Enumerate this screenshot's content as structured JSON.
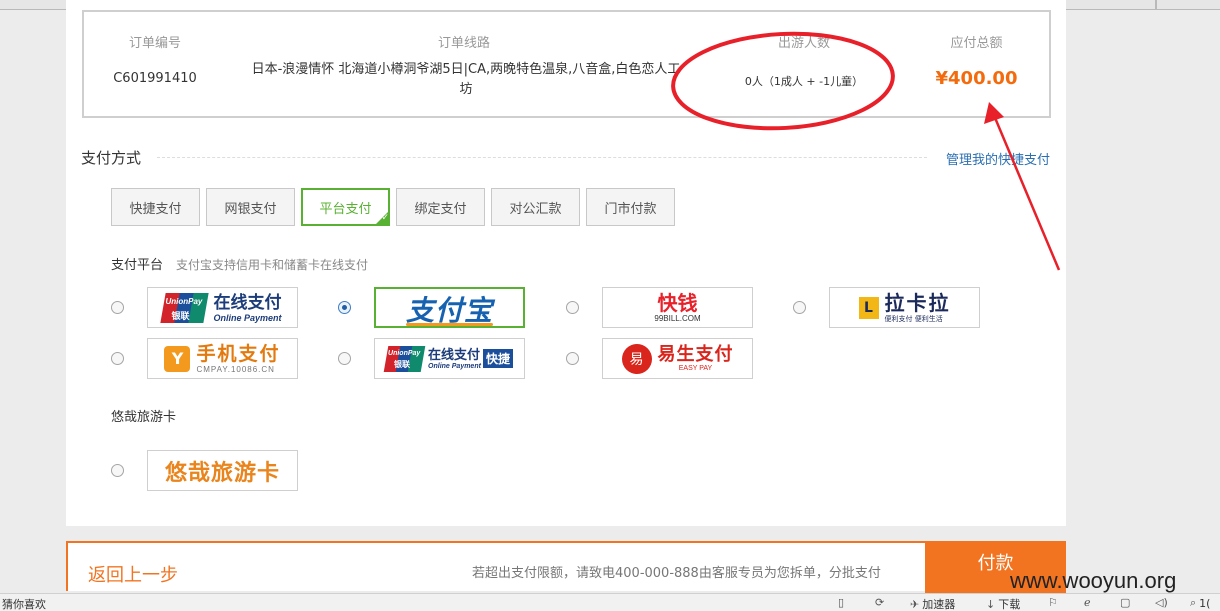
{
  "order": {
    "headers": {
      "order_no": "订单编号",
      "route": "订单线路",
      "travelers": "出游人数",
      "total": "应付总额"
    },
    "order_no": "C601991410",
    "route_line1": "日本-浪漫情怀 北海道小樽洞爷湖5日|CA,两晚特色温泉,八音盒,白色恋人工",
    "route_line2": "坊",
    "travelers": "0人（1成人 + -1儿童）",
    "total": "¥400.00"
  },
  "payment": {
    "title": "支付方式",
    "manage_link": "管理我的快捷支付",
    "methods": [
      "快捷支付",
      "网银支付",
      "平台支付",
      "绑定支付",
      "对公汇款",
      "门市付款"
    ],
    "selected_method": "平台支付",
    "platform_label": "支付平台",
    "platform_hint": "支付宝支持信用卡和储蓄卡在线支付",
    "platforms": {
      "unionpay": {
        "badge_en": "UnionPay",
        "badge_cn": "银联",
        "cn": "在线支付",
        "en": "Online Payment"
      },
      "alipay": {
        "text": "支付宝"
      },
      "kuaiqian": {
        "cn": "快钱",
        "en": "99BILL.COM"
      },
      "lakala": {
        "cn": "拉卡拉",
        "en": "便利支付 便利生活",
        "mark": "L"
      },
      "cmpay": {
        "cn": "手机支付",
        "en": "CMPAY.10086.CN",
        "mark": "Y"
      },
      "unionpay_quick": {
        "badge_en": "UnionPay",
        "badge_cn": "银联",
        "cn": "在线支付",
        "en": "Online Payment",
        "box": "快捷"
      },
      "easypay": {
        "cn": "易生支付",
        "en": "EASY PAY",
        "mark": "易"
      }
    },
    "selected_platform": "支付宝",
    "card_label": "悠哉旅游卡",
    "card_logo": "悠哉旅游卡"
  },
  "footer": {
    "back": "返回上一步",
    "limit_note": "若超出支付限额，请致电400-000-888由客服专员为您拆单，分批支付",
    "pay": "付款"
  },
  "watermark": "www.wooyun.org",
  "statusbar": {
    "left": "猜你喜欢",
    "accelerator": "加速器",
    "download": "下载",
    "zoom": "1("
  },
  "colors": {
    "accent_orange": "#f27421",
    "price_orange": "#f36b0c",
    "selected_green": "#58b132",
    "link_blue": "#2a6fb3",
    "annotation_red": "#e8202a"
  }
}
